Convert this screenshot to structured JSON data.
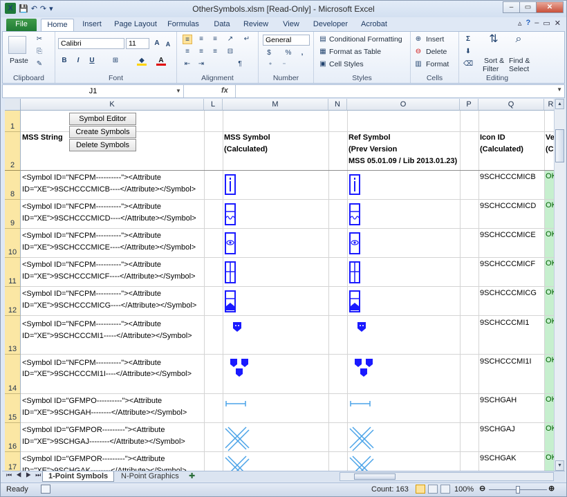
{
  "window": {
    "title": "OtherSymbols.xlsm  [Read-Only]  -  Microsoft Excel",
    "buttons": {
      "minimize": "–",
      "restore": "▭",
      "close": "✕"
    }
  },
  "qat": {
    "app_icon": "X",
    "save": "💾",
    "undo": "↶",
    "redo": "↷",
    "customize": "▾"
  },
  "tabs": [
    "File",
    "Home",
    "Insert",
    "Page Layout",
    "Formulas",
    "Data",
    "Review",
    "View",
    "Developer",
    "Acrobat"
  ],
  "ribbon": {
    "clipboard": {
      "label": "Clipboard",
      "paste": "Paste"
    },
    "font": {
      "label": "Font",
      "name": "Calibri",
      "size": "11",
      "bold": "B",
      "italic": "I",
      "underline": "U"
    },
    "alignment": {
      "label": "Alignment"
    },
    "number": {
      "label": "Number",
      "format": "General",
      "currency": "$",
      "percent": "%",
      "comma": ","
    },
    "styles": {
      "label": "Styles",
      "conditional": "Conditional Formatting",
      "table": "Format as Table",
      "cell": "Cell Styles"
    },
    "cells": {
      "label": "Cells",
      "insert": "Insert",
      "delete": "Delete",
      "format": "Format"
    },
    "editing": {
      "label": "Editing",
      "sum": "Σ",
      "sort": "Sort &",
      "sort2": "Filter",
      "find": "Find &",
      "find2": "Select"
    }
  },
  "formula_bar": {
    "name_box": "J1",
    "fx": "fx",
    "value": ""
  },
  "columns": [
    "K",
    "L",
    "M",
    "N",
    "O",
    "P",
    "Q",
    "R"
  ],
  "sheet_buttons": [
    "Symbol Editor",
    "Create Symbols",
    "Delete Symbols"
  ],
  "headers": {
    "k": "MSS String",
    "m1": "MSS Symbol",
    "m2": "(Calculated)",
    "o1": "Ref Symbol",
    "o2": "(Prev Version",
    "o3": "MSS 05.01.09 / Lib 2013.01.23)",
    "q1": "Icon ID",
    "q2": "(Calculated)",
    "r1": "Ve",
    "r2": "(C"
  },
  "rows": [
    {
      "num": "8",
      "line1": "<Symbol ID=\"NFCPM----------\"><Attribute",
      "line2": "ID=\"XE\">9SCHCCCMICB----</Attribute></Symbol>",
      "icon_id": "9SCHCCCMICB",
      "status": "OK",
      "symbol": "info"
    },
    {
      "num": "9",
      "line1": "<Symbol ID=\"NFCPM----------\"><Attribute",
      "line2": "ID=\"XE\">9SCHCCCMICD----</Attribute></Symbol>",
      "icon_id": "9SCHCCCMICD",
      "status": "OK",
      "symbol": "wave"
    },
    {
      "num": "10",
      "line1": "<Symbol ID=\"NFCPM----------\"><Attribute",
      "line2": "ID=\"XE\">9SCHCCCMICE----</Attribute></Symbol>",
      "icon_id": "9SCHCCCMICE",
      "status": "OK",
      "symbol": "eye"
    },
    {
      "num": "11",
      "line1": "<Symbol ID=\"NFCPM----------\"><Attribute",
      "line2": "ID=\"XE\">9SCHCCCMICF----</Attribute></Symbol>",
      "icon_id": "9SCHCCCMICF",
      "status": "OK",
      "symbol": "grid"
    },
    {
      "num": "12",
      "line1": "<Symbol ID=\"NFCPM----------\"><Attribute",
      "line2": "ID=\"XE\">9SCHCCCMICG----</Attribute></Symbol>",
      "icon_id": "9SCHCCCMICG",
      "status": "OK",
      "symbol": "house"
    },
    {
      "num": "13",
      "line1": "<Symbol ID=\"NFCPM----------\"><Attribute",
      "line2": "ID=\"XE\">9SCHCCCMI1-----</Attribute></Symbol>",
      "icon_id": "9SCHCCCMI1",
      "status": "OK",
      "symbol": "shield1"
    },
    {
      "num": "14",
      "line1": "<Symbol ID=\"NFCPM----------\"><Attribute",
      "line2": "ID=\"XE\">9SCHCCCMI1I----</Attribute></Symbol>",
      "icon_id": "9SCHCCCMI1I",
      "status": "OK",
      "symbol": "shield3"
    },
    {
      "num": "15",
      "line1": "<Symbol ID=\"GFMPO----------\"><Attribute",
      "line2": "ID=\"XE\">9SCHGAH--------</Attribute></Symbol>",
      "icon_id": "9SCHGAH",
      "status": "OK",
      "symbol": "bracket"
    },
    {
      "num": "16",
      "line1": "<Symbol ID=\"GFMPOR---------\"><Attribute",
      "line2": "ID=\"XE\">9SCHGAJ--------</Attribute></Symbol>",
      "icon_id": "9SCHGAJ",
      "status": "OK",
      "symbol": "cross"
    },
    {
      "num": "17",
      "line1": "<Symbol ID=\"GFMPOR---------\"><Attribute",
      "line2": "ID=\"XE\">9SCHGAK--------</Attribute></Symbol>",
      "icon_id": "9SCHGAK",
      "status": "OK",
      "symbol": "cross2"
    }
  ],
  "sheet_tabs": [
    "1-Point Symbols",
    "N-Point Graphics"
  ],
  "status": {
    "ready": "Ready",
    "count": "Count: 163",
    "zoom": "100%",
    "zoom_level_pct": 50
  },
  "colors": {
    "symbol": "#1a1aff",
    "line_symbol": "#4aa3e8",
    "ok_bg": "#c6efce",
    "ok_fg": "#006100",
    "row_header_sel": "#fbe7a4"
  }
}
